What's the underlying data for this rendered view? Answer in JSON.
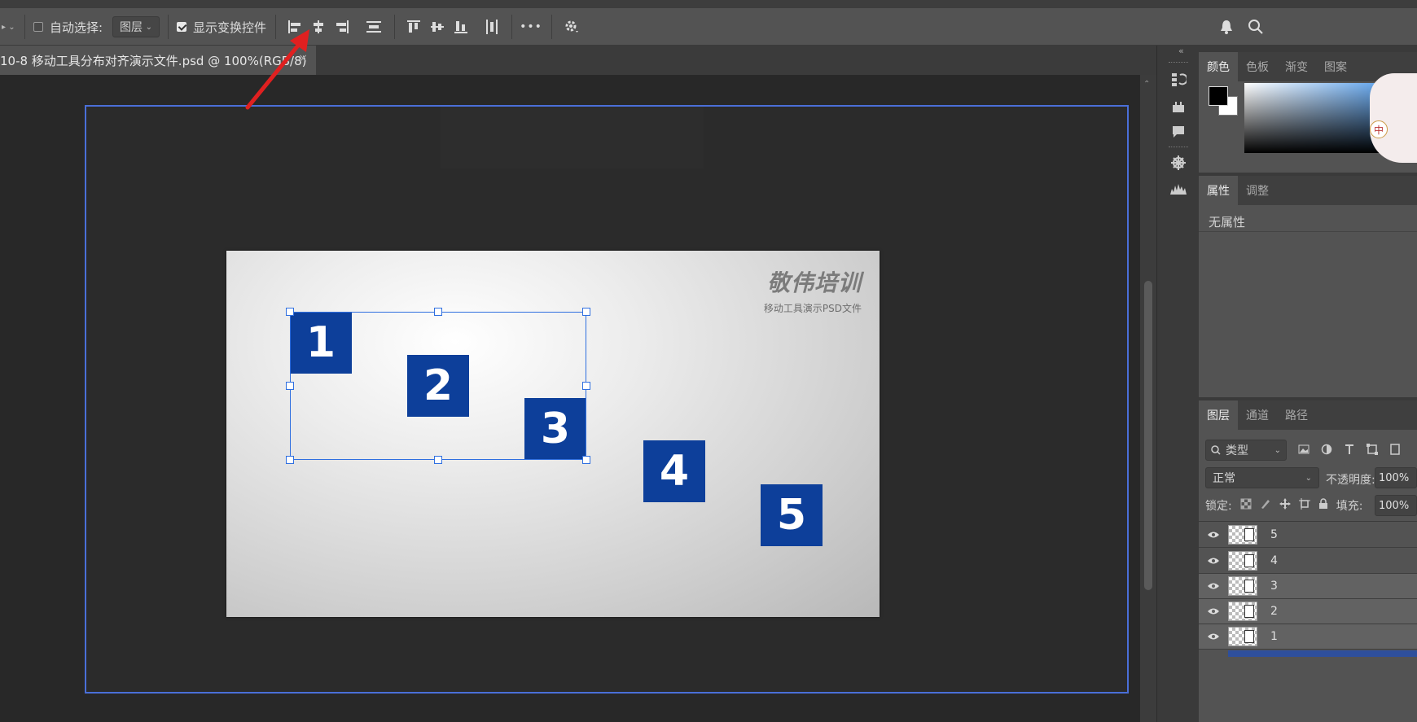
{
  "toolbar": {
    "auto_select_label": "自动选择:",
    "auto_select_value": "图层",
    "show_transform_label": "显示变换控件",
    "more_label": "•••"
  },
  "document": {
    "tab_title": "10-8 移动工具分布对齐演示文件.psd @ 100%(RGB/8)",
    "close_glyph": "×"
  },
  "canvas": {
    "squares": [
      "1",
      "2",
      "3",
      "4",
      "5"
    ],
    "logo_title": "敬伟培训",
    "logo_subtitle": "移动工具演示PSD文件",
    "square_color": "#0d3f9a"
  },
  "color_panel": {
    "tabs": [
      "颜色",
      "色板",
      "渐变",
      "图案"
    ],
    "ime_badge": "中"
  },
  "properties_panel": {
    "tabs": [
      "属性",
      "调整"
    ],
    "empty_text": "无属性"
  },
  "layers_panel": {
    "tabs": [
      "图层",
      "通道",
      "路径"
    ],
    "filter_placeholder": "类型",
    "blend_mode": "正常",
    "opacity_label": "不透明度:",
    "opacity_value": "100%",
    "lock_label": "锁定:",
    "fill_label": "填充:",
    "fill_value": "100%",
    "layers": [
      {
        "name": "5",
        "selected": false
      },
      {
        "name": "4",
        "selected": false
      },
      {
        "name": "3",
        "selected": true
      },
      {
        "name": "2",
        "selected": true
      },
      {
        "name": "1",
        "selected": true
      }
    ]
  },
  "colors": {
    "accent": "#4a6fd8",
    "arrow": "#e02020",
    "selection": "#2f6fe0"
  }
}
